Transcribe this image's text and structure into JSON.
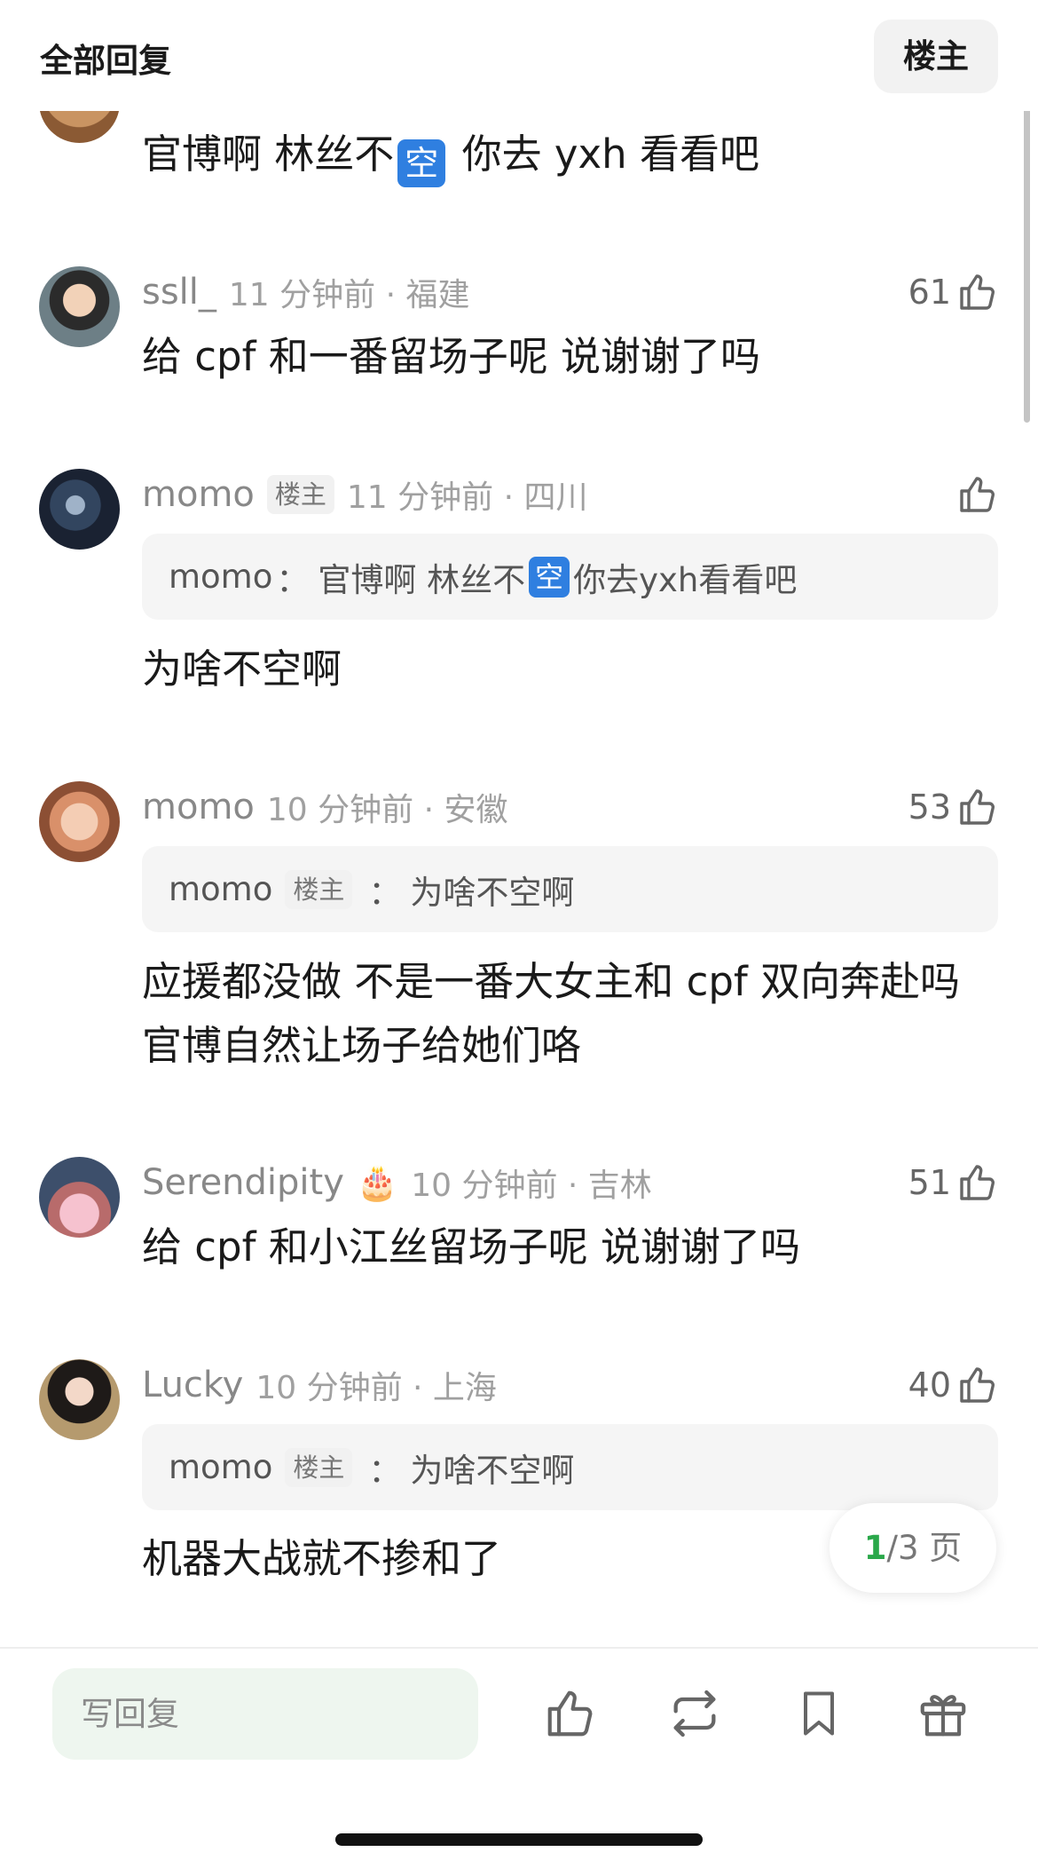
{
  "header": {
    "title": "全部回复",
    "op_filter_label": "楼主"
  },
  "comments": [
    {
      "text_before": "官博啊 林丝不",
      "emoji": "空",
      "text_after": " 你去 yxh 看看吧"
    },
    {
      "username": "ssll_",
      "time_location": "11 分钟前 · 福建",
      "likes": "61",
      "text": "给 cpf 和一番留场子呢 说谢谢了吗"
    },
    {
      "username": "momo",
      "op_badge": "楼主",
      "time_location": "11 分钟前 · 四川",
      "quote": {
        "author": "momo",
        "separator": "：",
        "text_before": "官博啊 林丝不",
        "emoji": "空",
        "text_after": " 你去yxh看看吧"
      },
      "text": "为啥不空啊"
    },
    {
      "username": "momo",
      "time_location": "10 分钟前 · 安徽",
      "likes": "53",
      "quote": {
        "author": "momo",
        "op_badge": "楼主",
        "separator": "：",
        "text": "为啥不空啊"
      },
      "text": "应援都没做 不是一番大女主和 cpf 双向奔赴吗 官博自然让场子给她们咯"
    },
    {
      "username": "Serendipity",
      "badge": "🎂",
      "time_location": "10 分钟前 · 吉林",
      "likes": "51",
      "text": "给 cpf 和小江丝留场子呢 说谢谢了吗"
    },
    {
      "username": "Lucky",
      "time_location": "10 分钟前 · 上海",
      "likes": "40",
      "quote": {
        "author": "momo",
        "op_badge": "楼主",
        "separator": "：",
        "text": "为啥不空啊"
      },
      "text": "机器大战就不掺和了"
    }
  ],
  "pagination": {
    "current": "1",
    "total_label": "/3 页"
  },
  "bottom_bar": {
    "reply_placeholder": "写回复"
  },
  "icons": {
    "like": "thumbs-up-icon",
    "repost": "repost-icon",
    "bookmark": "bookmark-icon",
    "gift": "gift-icon"
  },
  "colors": {
    "accent": "#2aa84a",
    "reply_input_bg": "#eef6ef",
    "emoji_blue": "#2f7fe0",
    "quote_bg": "#f5f5f5",
    "meta_gray": "#888888"
  }
}
